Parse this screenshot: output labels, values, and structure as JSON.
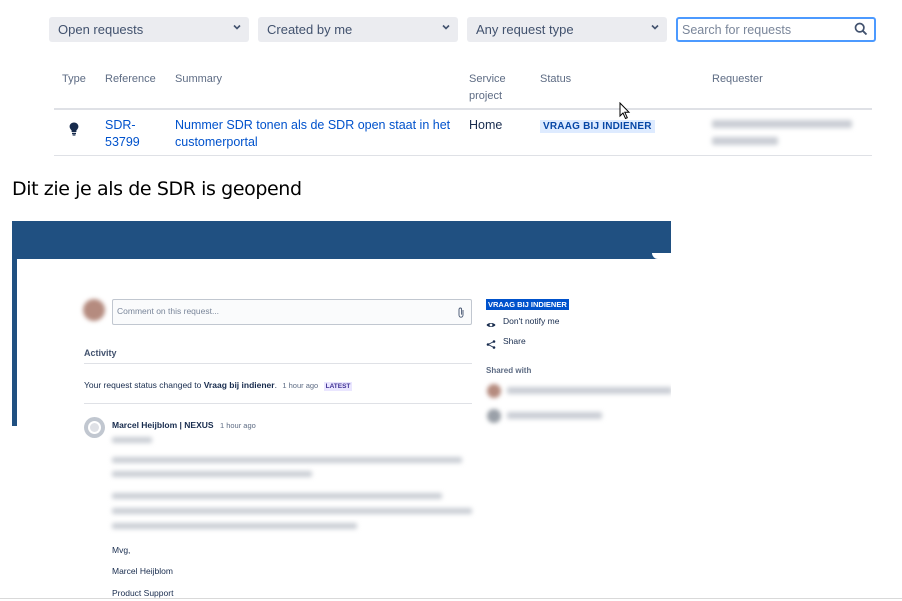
{
  "filters": {
    "status": "Open requests",
    "creator": "Created by me",
    "type": "Any request type",
    "search_placeholder": "Search for requests"
  },
  "table": {
    "headers": {
      "type": "Type",
      "reference": "Reference",
      "summary": "Summary",
      "service_project_line1": "Service",
      "service_project_line2": "project",
      "status": "Status",
      "requester": "Requester"
    },
    "rows": [
      {
        "type_icon": "lightbulb-icon",
        "reference_line1": "SDR-",
        "reference_line2": "53799",
        "summary_line1": "Nummer SDR tonen als de SDR open staat in het",
        "summary_line2": "customerportal",
        "service_project": "Home",
        "status": "VRAAG BIJ INDIENER"
      }
    ]
  },
  "caption": "Dit zie je als de SDR is geopend",
  "detail": {
    "comment_placeholder": "Comment on this request...",
    "status_lozenge": "VRAAG BIJ INDIENER",
    "dont_notify": "Don't notify me",
    "share": "Share",
    "shared_with": "Shared with",
    "activity": "Activity",
    "status_change_prefix": "Your request status changed to",
    "status_change_value": "Vraag bij indiener",
    "status_change_suffix": ".",
    "status_change_time": "1 hour ago",
    "latest_badge": "LATEST",
    "comment_author": "Marcel Heijblom | NEXUS",
    "comment_time": "1 hour ago",
    "comment_sign_1": "Mvg,",
    "comment_sign_2": "Marcel Heijblom",
    "comment_sign_3": "Product Support"
  },
  "colors": {
    "accent": "#0052cc",
    "header_band": "#205081",
    "lozenge_bg": "#deebff",
    "lozenge_text": "#0747a6",
    "focus_border": "#4c9aff"
  }
}
